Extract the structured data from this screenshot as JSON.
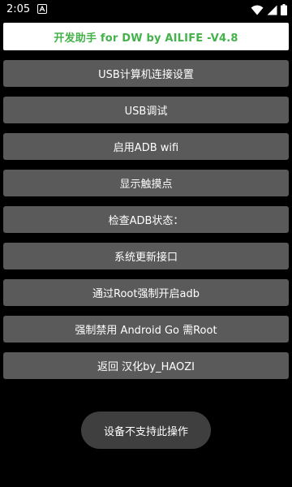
{
  "status_bar": {
    "time": "2:05",
    "icons": [
      "notification-a-icon",
      "wifi-icon",
      "signal-icon",
      "battery-icon"
    ]
  },
  "app": {
    "title": "开发助手 for DW by AILIFE -V4.8",
    "title_color": "#44b24a"
  },
  "menu": {
    "items": [
      {
        "label": "USB计算机连接设置"
      },
      {
        "label": "USB调试"
      },
      {
        "label": "启用ADB wifi"
      },
      {
        "label": "显示触摸点"
      },
      {
        "label": "检查ADB状态："
      },
      {
        "label": "系统更新接口"
      },
      {
        "label": "通过Root强制开启adb"
      },
      {
        "label": "强制禁用 Android Go 需Root"
      },
      {
        "label": "返回 汉化by_HAOZI"
      }
    ],
    "button_color": "#5a5a5a"
  },
  "toast": {
    "message": "设备不支持此操作"
  }
}
